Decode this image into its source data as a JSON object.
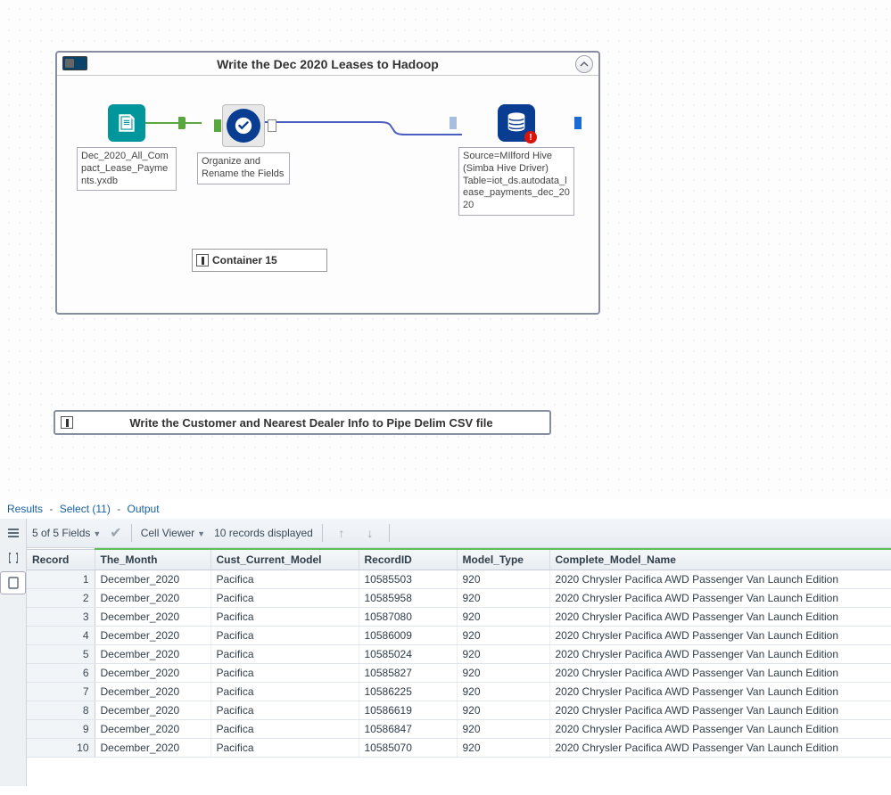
{
  "canvas": {
    "container1": {
      "title": "Write the Dec 2020 Leases  to Hadoop",
      "input_tool": {
        "label": "Dec_2020_All_Compact_Lease_Payments.yxdb"
      },
      "select_tool": {
        "label": "Organize and Rename the Fields"
      },
      "output_tool": {
        "label": "Source=MIlford Hive (Simba Hive Driver) Table=iot_ds.autodata_lease_payments_dec_2020"
      },
      "mini_container_label": "Container 15"
    },
    "container2": {
      "title": "Write the Customer and Nearest Dealer Info to Pipe Delim CSV file"
    }
  },
  "results": {
    "breadcrumb": {
      "a": "Results",
      "b": "Select (11)",
      "c": "Output"
    },
    "toolbar": {
      "fields_text": "5 of 5 Fields",
      "cell_viewer": "Cell Viewer",
      "records_text": "10 records displayed"
    },
    "columns": [
      "Record",
      "The_Month",
      "Cust_Current_Model",
      "RecordID",
      "Model_Type",
      "Complete_Model_Name"
    ],
    "rows": [
      {
        "n": "1",
        "month": "December_2020",
        "model": "Pacifica",
        "rid": "10585503",
        "mtype": "920",
        "name": "2020 Chrysler Pacifica AWD Passenger Van Launch Edition"
      },
      {
        "n": "2",
        "month": "December_2020",
        "model": "Pacifica",
        "rid": "10585958",
        "mtype": "920",
        "name": "2020 Chrysler Pacifica AWD Passenger Van Launch Edition"
      },
      {
        "n": "3",
        "month": "December_2020",
        "model": "Pacifica",
        "rid": "10587080",
        "mtype": "920",
        "name": "2020 Chrysler Pacifica AWD Passenger Van Launch Edition"
      },
      {
        "n": "4",
        "month": "December_2020",
        "model": "Pacifica",
        "rid": "10586009",
        "mtype": "920",
        "name": "2020 Chrysler Pacifica AWD Passenger Van Launch Edition"
      },
      {
        "n": "5",
        "month": "December_2020",
        "model": "Pacifica",
        "rid": "10585024",
        "mtype": "920",
        "name": "2020 Chrysler Pacifica AWD Passenger Van Launch Edition"
      },
      {
        "n": "6",
        "month": "December_2020",
        "model": "Pacifica",
        "rid": "10585827",
        "mtype": "920",
        "name": "2020 Chrysler Pacifica AWD Passenger Van Launch Edition"
      },
      {
        "n": "7",
        "month": "December_2020",
        "model": "Pacifica",
        "rid": "10586225",
        "mtype": "920",
        "name": "2020 Chrysler Pacifica AWD Passenger Van Launch Edition"
      },
      {
        "n": "8",
        "month": "December_2020",
        "model": "Pacifica",
        "rid": "10586619",
        "mtype": "920",
        "name": "2020 Chrysler Pacifica AWD Passenger Van Launch Edition"
      },
      {
        "n": "9",
        "month": "December_2020",
        "model": "Pacifica",
        "rid": "10586847",
        "mtype": "920",
        "name": "2020 Chrysler Pacifica AWD Passenger Van Launch Edition"
      },
      {
        "n": "10",
        "month": "December_2020",
        "model": "Pacifica",
        "rid": "10585070",
        "mtype": "920",
        "name": "2020 Chrysler Pacifica AWD Passenger Van Launch Edition"
      }
    ]
  }
}
